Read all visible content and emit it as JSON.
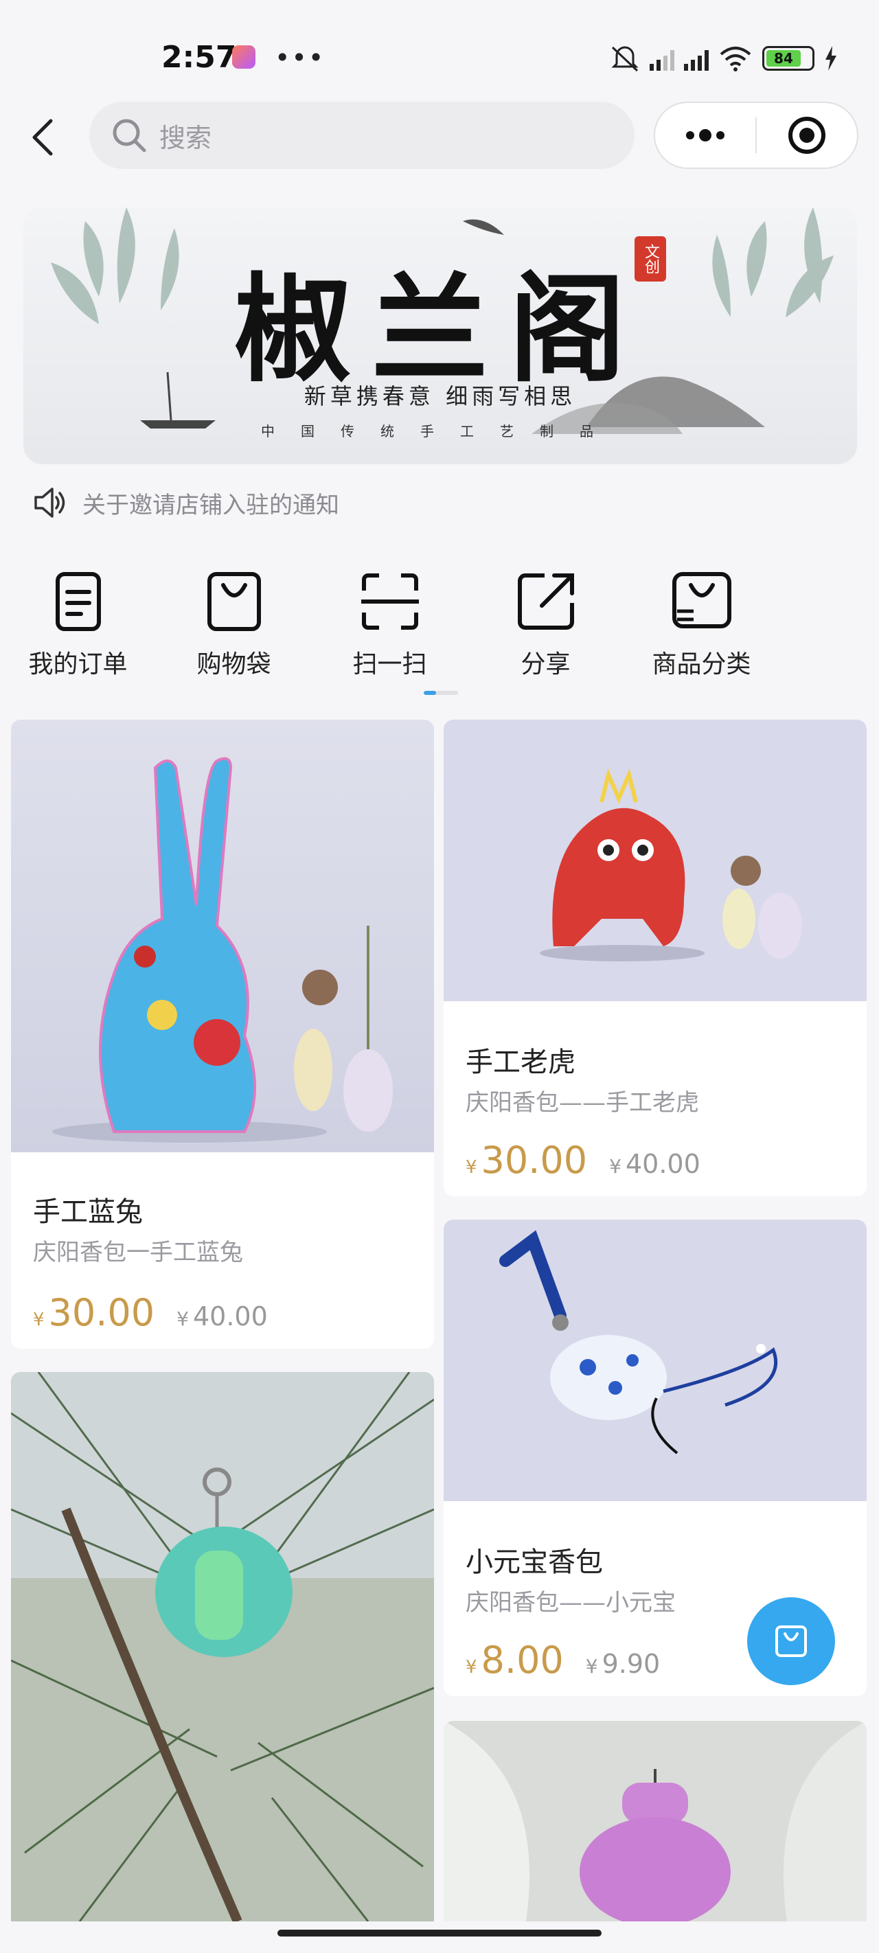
{
  "status_bar": {
    "time": "2:57",
    "more": "•••",
    "battery": "84"
  },
  "search": {
    "placeholder": "搜索"
  },
  "banner": {
    "title": "椒兰阁",
    "seal": "文创",
    "subtitle": "新草携春意 细雨写相思",
    "tagline": "中国传统手工艺制品"
  },
  "notice": {
    "text": "关于邀请店铺入驻的通知"
  },
  "menu": [
    {
      "label": "我的订单",
      "icon": "order-icon"
    },
    {
      "label": "购物袋",
      "icon": "bag-icon"
    },
    {
      "label": "扫一扫",
      "icon": "scan-icon"
    },
    {
      "label": "分享",
      "icon": "share-icon"
    },
    {
      "label": "商品分类",
      "icon": "category-icon"
    }
  ],
  "products": [
    {
      "title": "手工蓝兔",
      "subtitle": "庆阳香包一手工蓝兔",
      "currency": "¥",
      "price": "30.00",
      "original_price": "40.00"
    },
    {
      "title": "手工老虎",
      "subtitle": "庆阳香包——手工老虎",
      "currency": "¥",
      "price": "30.00",
      "original_price": "40.00"
    },
    {
      "title": "小元宝香包",
      "subtitle": "庆阳香包——小元宝",
      "currency": "¥",
      "price": "8.00",
      "original_price": "9.90"
    }
  ],
  "colors": {
    "accent": "#36a8ef",
    "price": "#c89a4a",
    "background": "#f6f6f8"
  }
}
